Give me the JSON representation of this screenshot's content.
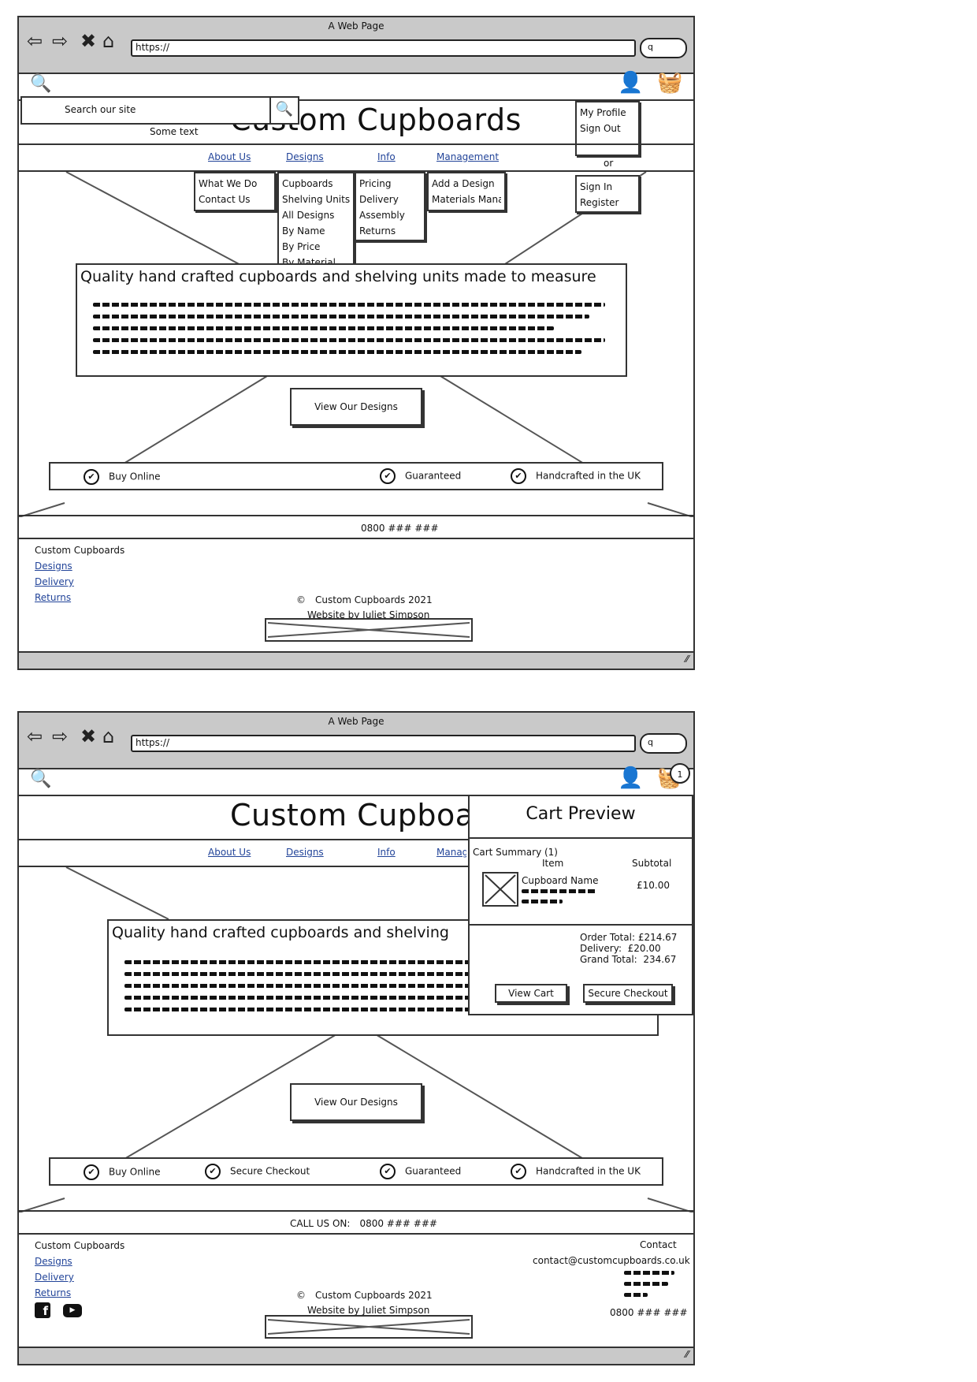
{
  "browser": {
    "title": "A Web Page",
    "url": "https://",
    "back_icon": "back-arrow-icon",
    "forward_icon": "forward-arrow-icon",
    "stop_icon": "close-icon",
    "home_icon": "home-icon",
    "search_glyph": "q"
  },
  "site": {
    "name": "Custom Cupboards",
    "search_placeholder": "Search our site",
    "some_text": "Some text",
    "nav": [
      "About Us",
      "Designs",
      "Info",
      "Management"
    ],
    "dropdowns": {
      "about": [
        "What We Do",
        "Contact Us"
      ],
      "designs": [
        "Cupboards",
        "Shelving Units",
        "All Designs",
        "By Name",
        "By Price",
        "By Material"
      ],
      "info": [
        "Pricing",
        "Delivery",
        "Assembly",
        "Returns"
      ],
      "management": [
        "Add a Design",
        "Materials Manag"
      ]
    },
    "account_logged_in": [
      "My Profile",
      "Sign Out"
    ],
    "account_or": "or",
    "account_logged_out": [
      "Sign In",
      "Register"
    ],
    "hero_heading": "Quality hand crafted cupboards and shelving units made to measure",
    "hero_heading_truncated": "Quality hand crafted cupboards and shelving",
    "hero_button": "View Our Designs",
    "features_top": [
      "Buy Online",
      "Guaranteed",
      "Handcrafted in the UK"
    ],
    "features_bottom": [
      "Buy Online",
      "Secure Checkout",
      "Guaranteed",
      "Handcrafted in the UK"
    ],
    "phone": "0800 ### ###",
    "call_us_label": "CALL US ON:",
    "footer_title": "Custom Cupboards",
    "footer_links": [
      "Designs",
      "Delivery",
      "Returns"
    ],
    "copyright_symbol": "©",
    "copyright": "Custom Cupboards 2021",
    "credit": "Website by Juliet Simpson",
    "contact_heading": "Contact",
    "contact_email": "contact@customcupboards.co.uk",
    "contact_phone": "0800 ### ###"
  },
  "cart": {
    "count": "1",
    "title": "Cart Preview",
    "summary": "Cart Summary (1)",
    "col_item": "Item",
    "col_subtotal": "Subtotal",
    "item_name": "Cupboard Name",
    "item_price": "£10.00",
    "order_total_label": "Order Total:",
    "order_total": "£214.67",
    "delivery_label": "Delivery:",
    "delivery": "£20.00",
    "grand_total_label": "Grand Total:",
    "grand_total": "234.67",
    "view_cart": "View Cart",
    "checkout": "Secure Checkout"
  }
}
